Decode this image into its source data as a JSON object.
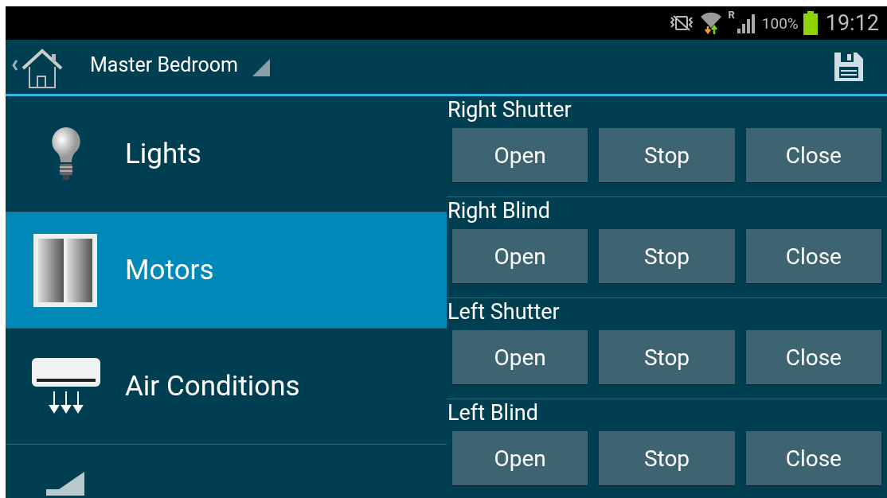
{
  "status_bar": {
    "network_type": "R",
    "battery": "100%",
    "time": "19:12"
  },
  "header": {
    "room": "Master Bedroom"
  },
  "menu": [
    {
      "kind": "lights",
      "label": "Lights",
      "selected": false
    },
    {
      "kind": "motors",
      "label": "Motors",
      "selected": true
    },
    {
      "kind": "climate",
      "label": "Air Conditions",
      "selected": false
    },
    {
      "kind": "audio",
      "selected": false
    }
  ],
  "motors": [
    {
      "name": "Right Shutter",
      "buttons": [
        "Open",
        "Stop",
        "Close"
      ]
    },
    {
      "name": "Right Blind",
      "buttons": [
        "Open",
        "Stop",
        "Close"
      ]
    },
    {
      "name": "Left Shutter",
      "buttons": [
        "Open",
        "Stop",
        "Close"
      ]
    },
    {
      "name": "Left Blind",
      "buttons": [
        "Open",
        "Stop",
        "Close"
      ]
    }
  ]
}
